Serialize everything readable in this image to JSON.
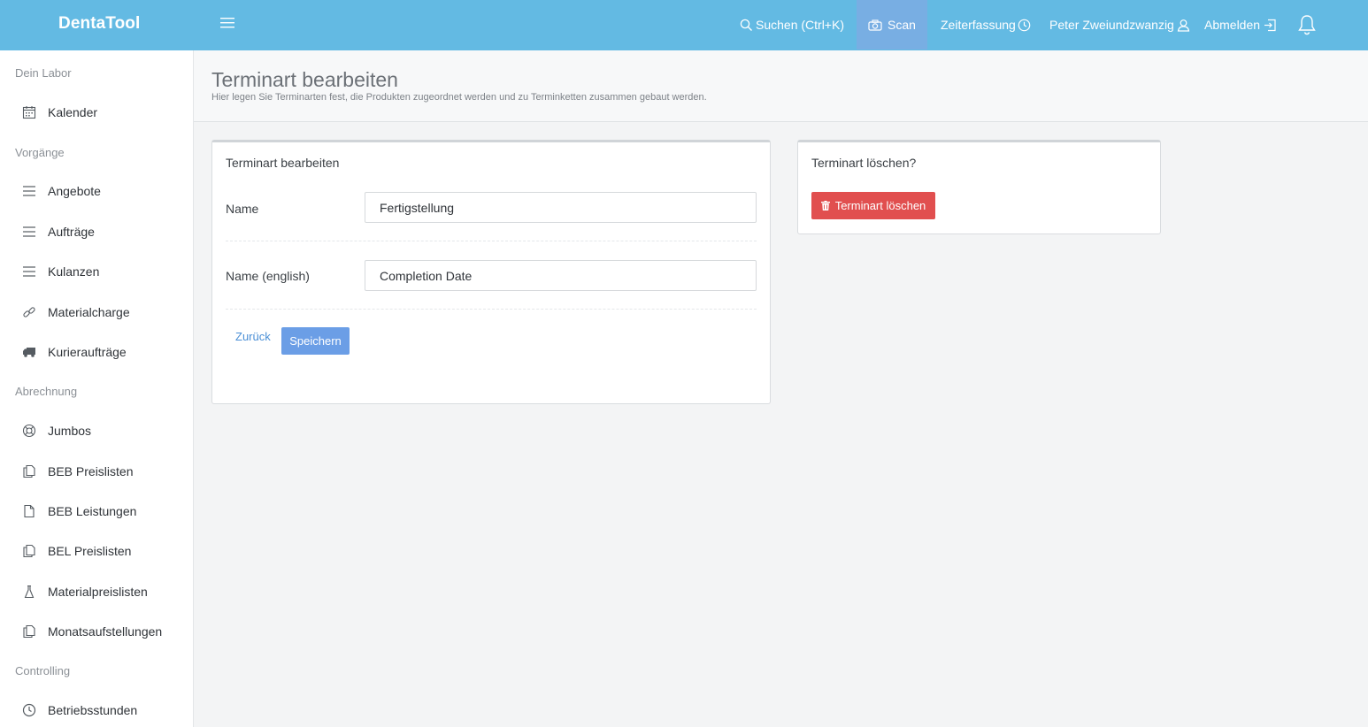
{
  "app": {
    "brand": "DentaTool"
  },
  "topbar": {
    "search_label": "Suchen (Ctrl+K)",
    "scan_label": "Scan",
    "time_tracking_label": "Zeiterfassung",
    "user_name": "Peter Zweiundzwanzig",
    "logout_label": "Abmelden"
  },
  "sidebar": {
    "sections": [
      {
        "title": "Dein Labor",
        "items": [
          {
            "label": "Kalender",
            "icon": "calendar-icon"
          }
        ]
      },
      {
        "title": "Vorgänge",
        "items": [
          {
            "label": "Angebote",
            "icon": "list-icon"
          },
          {
            "label": "Aufträge",
            "icon": "list-icon"
          },
          {
            "label": "Kulanzen",
            "icon": "list-icon"
          },
          {
            "label": "Materialcharge",
            "icon": "link-icon"
          },
          {
            "label": "Kurieraufträge",
            "icon": "truck-icon"
          }
        ]
      },
      {
        "title": "Abrechnung",
        "items": [
          {
            "label": "Jumbos",
            "icon": "lifebuoy-icon"
          },
          {
            "label": "BEB Preislisten",
            "icon": "documents-icon"
          },
          {
            "label": "BEB Leistungen",
            "icon": "document-icon"
          },
          {
            "label": "BEL Preislisten",
            "icon": "documents-icon"
          },
          {
            "label": "Materialpreislisten",
            "icon": "flask-icon"
          },
          {
            "label": "Monatsaufstellungen",
            "icon": "documents-icon"
          }
        ]
      },
      {
        "title": "Controlling",
        "items": [
          {
            "label": "Betriebsstunden",
            "icon": "clock-icon"
          }
        ]
      }
    ]
  },
  "page": {
    "title": "Terminart bearbeiten",
    "subtitle": "Hier legen Sie Terminarten fest, die Produkten zugeordnet werden und zu Terminketten zusammen gebaut werden."
  },
  "edit_card": {
    "title": "Terminart bearbeiten",
    "name_label": "Name",
    "name_value": "Fertigstellung",
    "name_en_label": "Name (english)",
    "name_en_value": "Completion Date",
    "back_label": "Zurück",
    "save_label": "Speichern"
  },
  "delete_card": {
    "title": "Terminart löschen?",
    "delete_label": "Terminart löschen"
  },
  "colors": {
    "topbar": "#63bae3",
    "scan_active": "#78aee3",
    "primary": "#6b9ee6",
    "danger": "#e14f4f",
    "link": "#4a8fd6"
  }
}
